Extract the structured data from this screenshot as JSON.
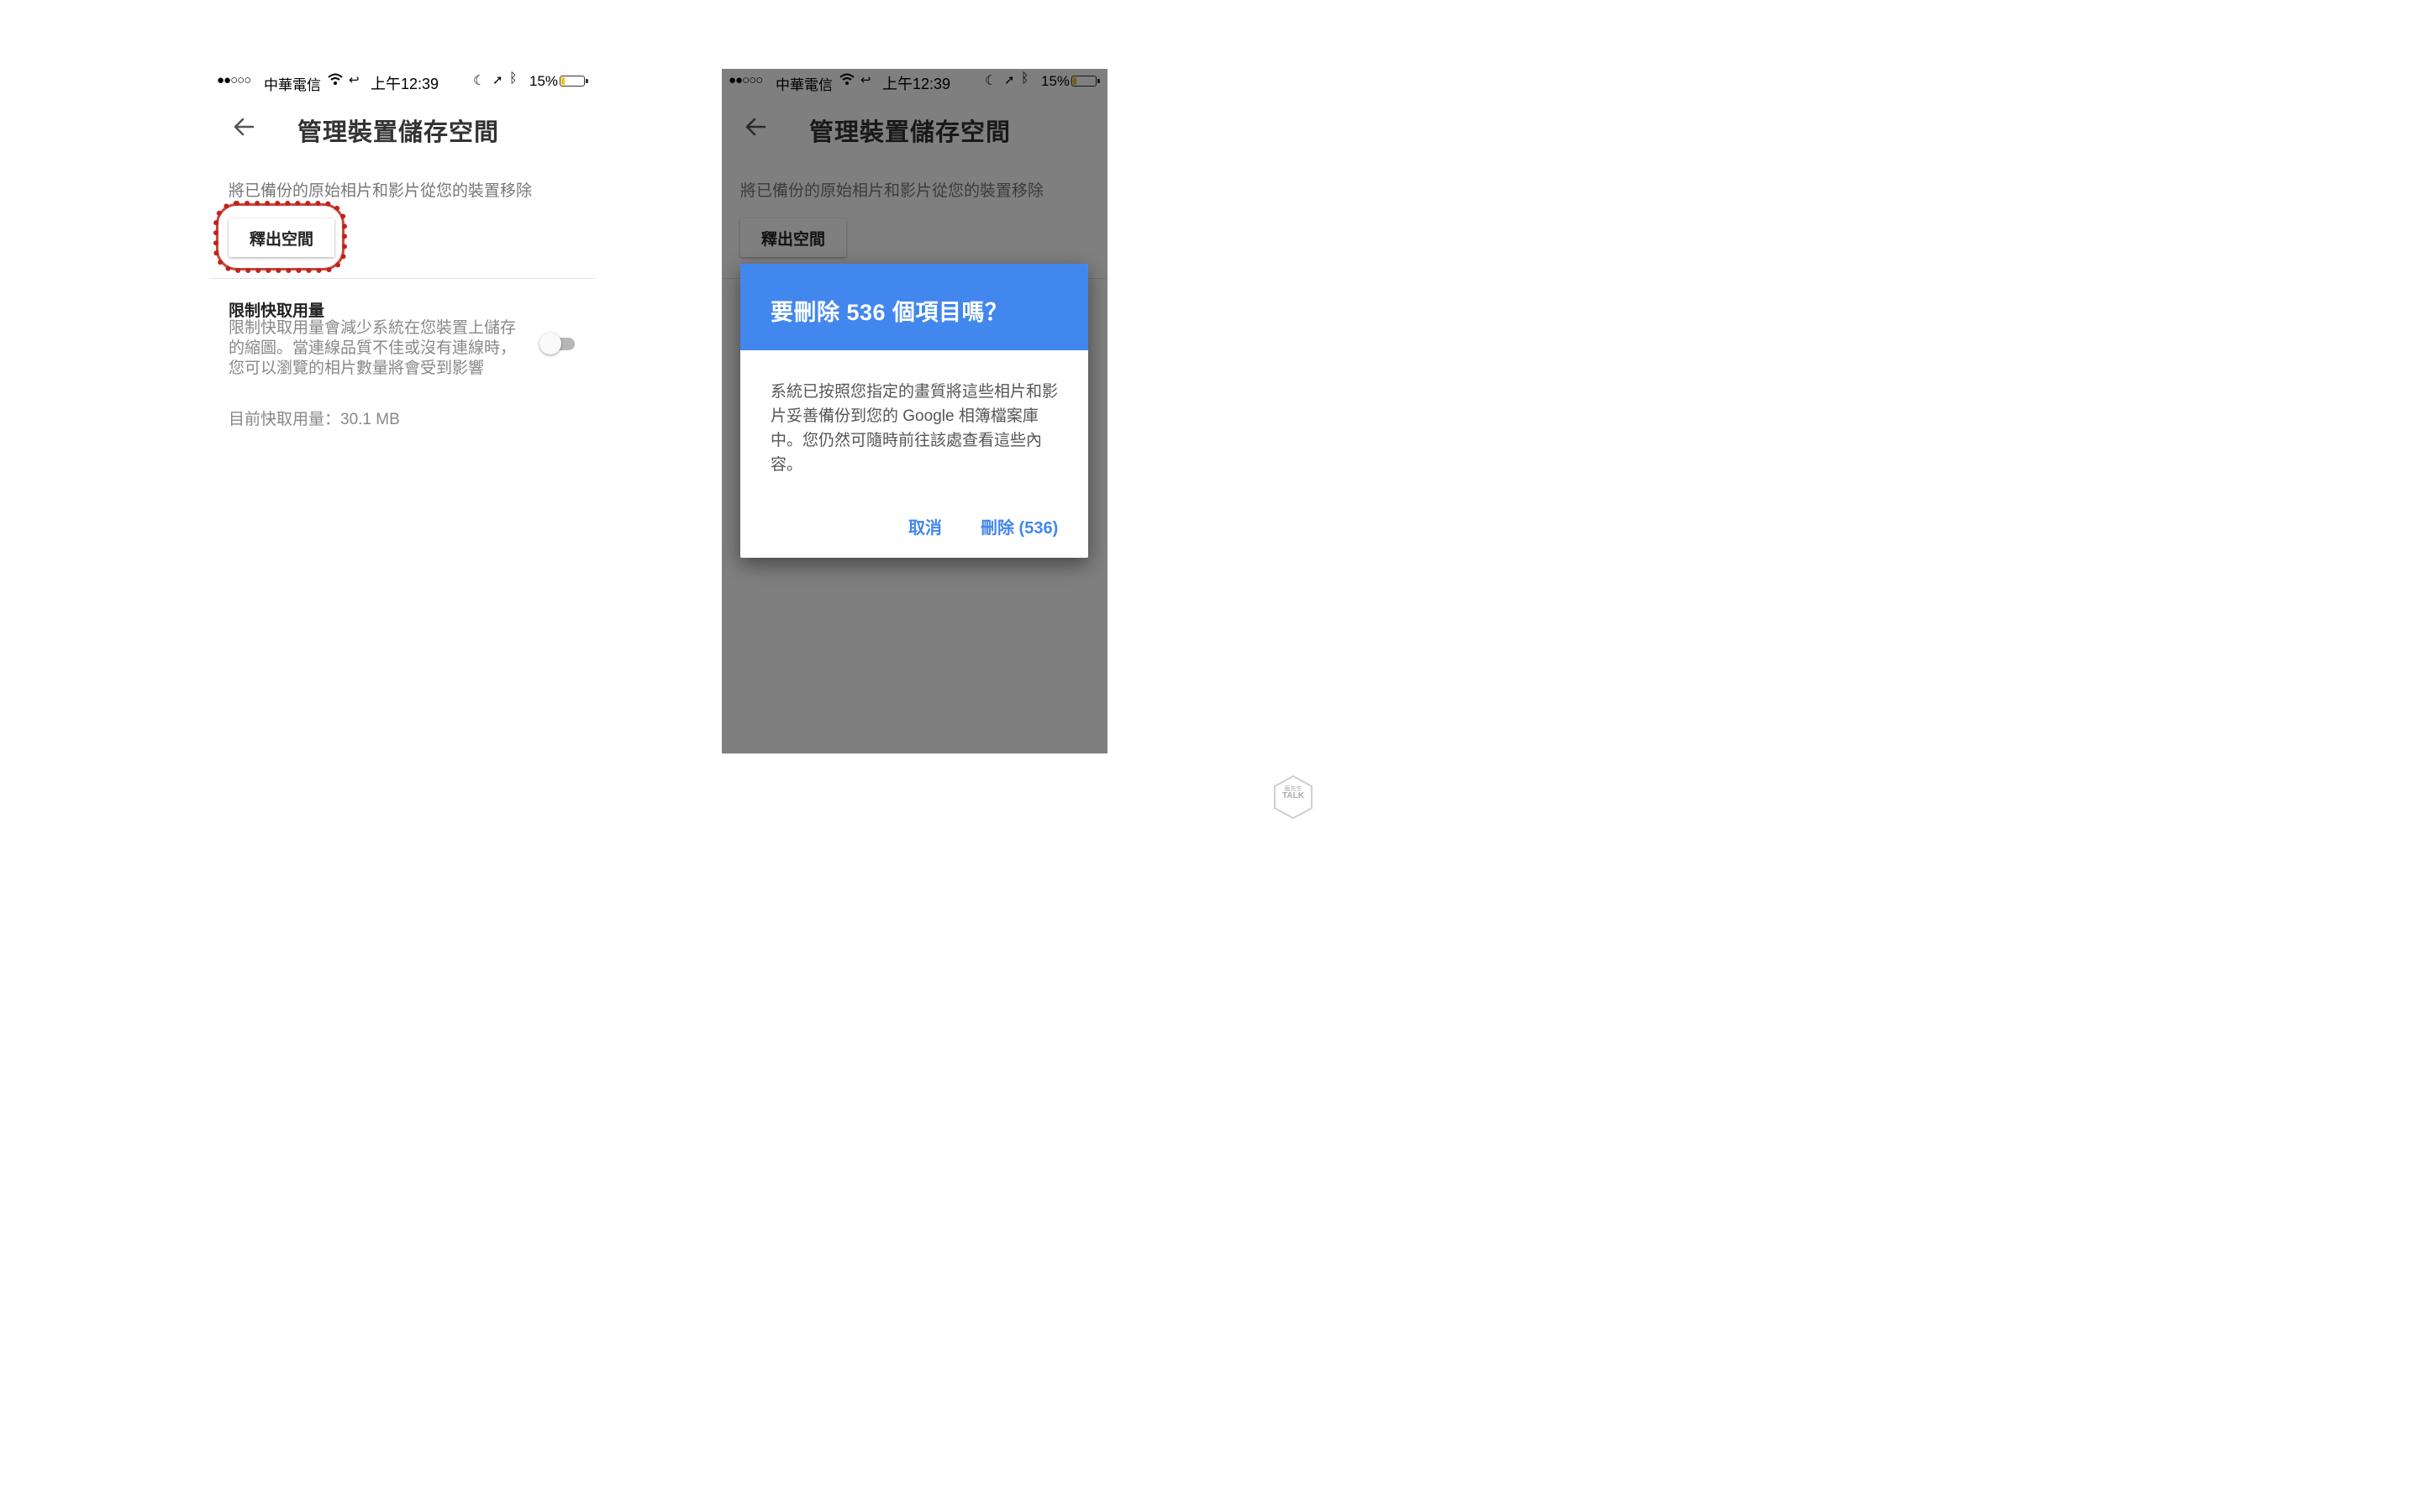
{
  "status_bar": {
    "signal": "●●○○○",
    "carrier": "中華電信",
    "call_icon": "↩",
    "time": "上午12:39",
    "moon_icon": "☾",
    "location_icon": "➚",
    "bluetooth_icon": "ᛒ",
    "battery": "15%",
    "battery_level": 0.15
  },
  "screen": {
    "back_icon": "arrow-left",
    "title": "管理裝置儲存空間",
    "free_section": {
      "description": "將已備份的原始相片和影片從您的裝置移除",
      "button_label": "釋出空間"
    },
    "cache_section": {
      "title": "限制快取用量",
      "description": "限制快取用量會減少系統在您裝置上儲存的縮圖。當連線品質不佳或沒有連線時，您可以瀏覽的相片數量將會受到影響",
      "usage": "目前快取用量：30.1 MB",
      "toggle_on": false
    }
  },
  "dialog": {
    "title": "要刪除 536 個項目嗎？",
    "body": "系統已按照您指定的畫質將這些相片和影片妥善備份到您的 Google 相簿檔案庫中。您仍然可隨時前往該處查看這些內容。",
    "cancel_label": "取消",
    "delete_label": "刪除 (536)",
    "header_color": "#4287ee"
  },
  "highlight_color": "#c1231b",
  "watermark": {
    "text_line1": "瘋先生",
    "text_line2": "TALK"
  }
}
